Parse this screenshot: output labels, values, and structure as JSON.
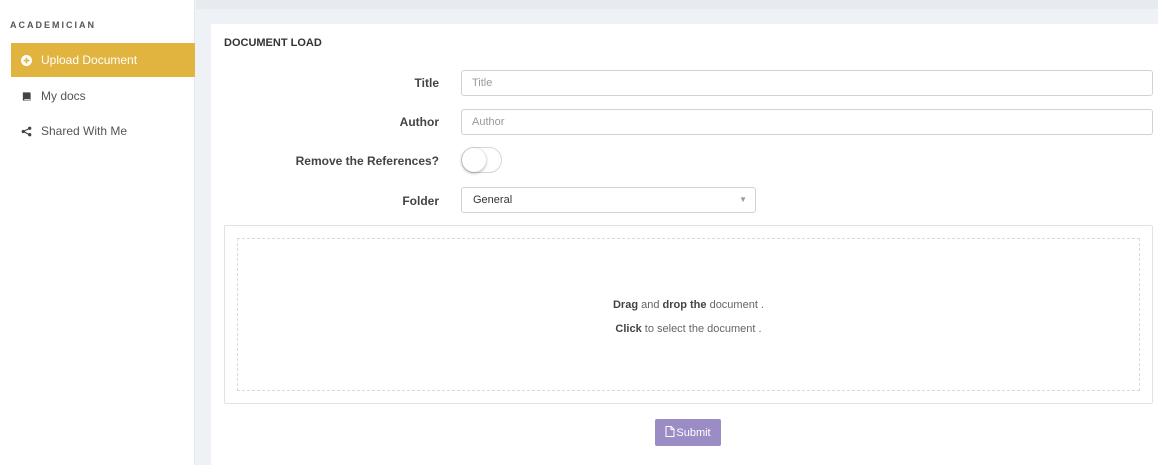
{
  "sidebar": {
    "brand": "ACADEMICIAN",
    "items": [
      {
        "label": "Upload Document",
        "icon": "plus-circle-icon",
        "active": true
      },
      {
        "label": "My docs",
        "icon": "book-icon",
        "active": false
      },
      {
        "label": "Shared With Me",
        "icon": "share-icon",
        "active": false
      }
    ]
  },
  "panel": {
    "title": "DOCUMENT LOAD",
    "fields": {
      "title": {
        "label": "Title",
        "placeholder": "Title",
        "value": ""
      },
      "author": {
        "label": "Author",
        "placeholder": "Author",
        "value": ""
      },
      "remove_refs": {
        "label": "Remove the References?",
        "checked": false
      },
      "folder": {
        "label": "Folder",
        "selected": "General"
      }
    },
    "dropzone": {
      "line1": {
        "b1": "Drag",
        "t1": " and ",
        "b2": "drop the",
        "t2": " document ."
      },
      "line2": {
        "b1": "Click",
        "t1": " to select the document ."
      }
    },
    "submit_label": "Submit"
  },
  "colors": {
    "accent": "#e1b33f",
    "submit": "#9c8cc6",
    "background": "#eef1f5"
  }
}
